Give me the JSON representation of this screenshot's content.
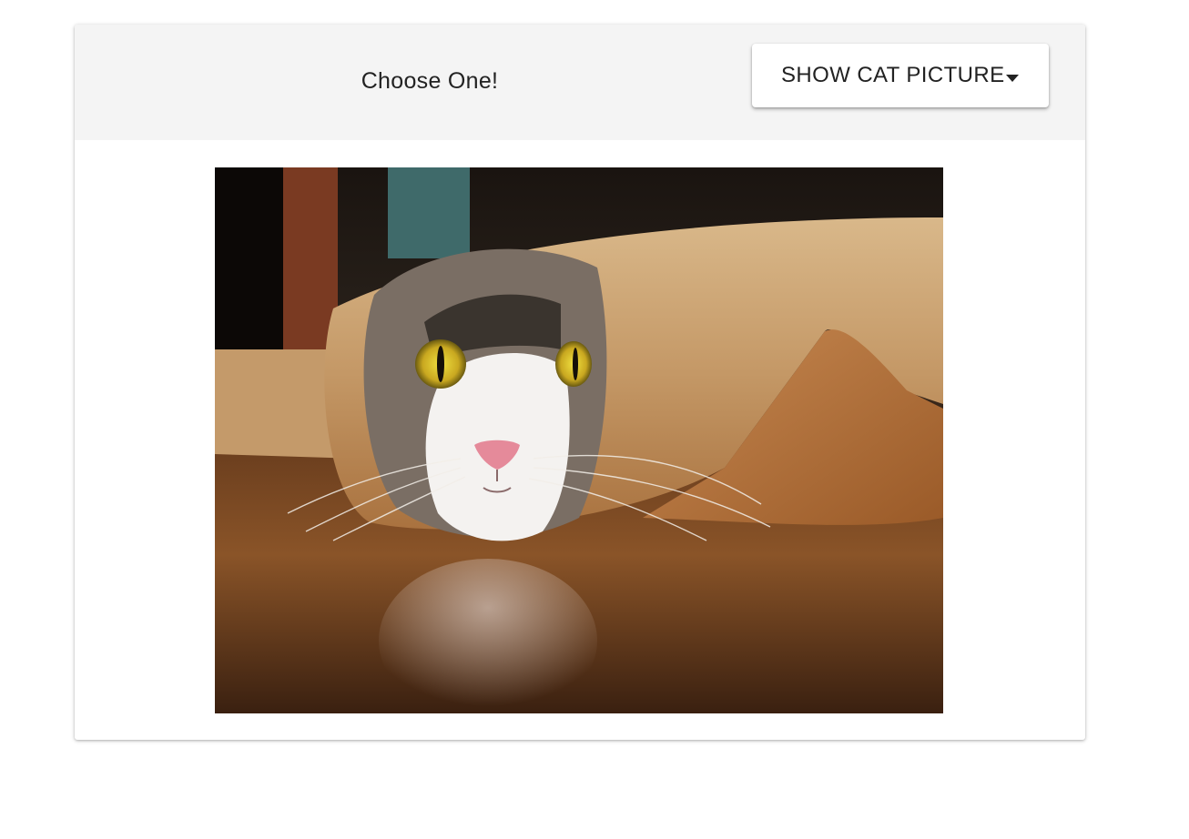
{
  "header": {
    "title": "Choose One!"
  },
  "dropdown": {
    "label": "Show Cat Picture",
    "caret_icon": "caret-down-icon"
  },
  "photo": {
    "icon": "cat-in-paper-roll-photo"
  },
  "colors": {
    "header_background": "#f4f4f4",
    "text": "#222222",
    "card_background": "#ffffff"
  }
}
